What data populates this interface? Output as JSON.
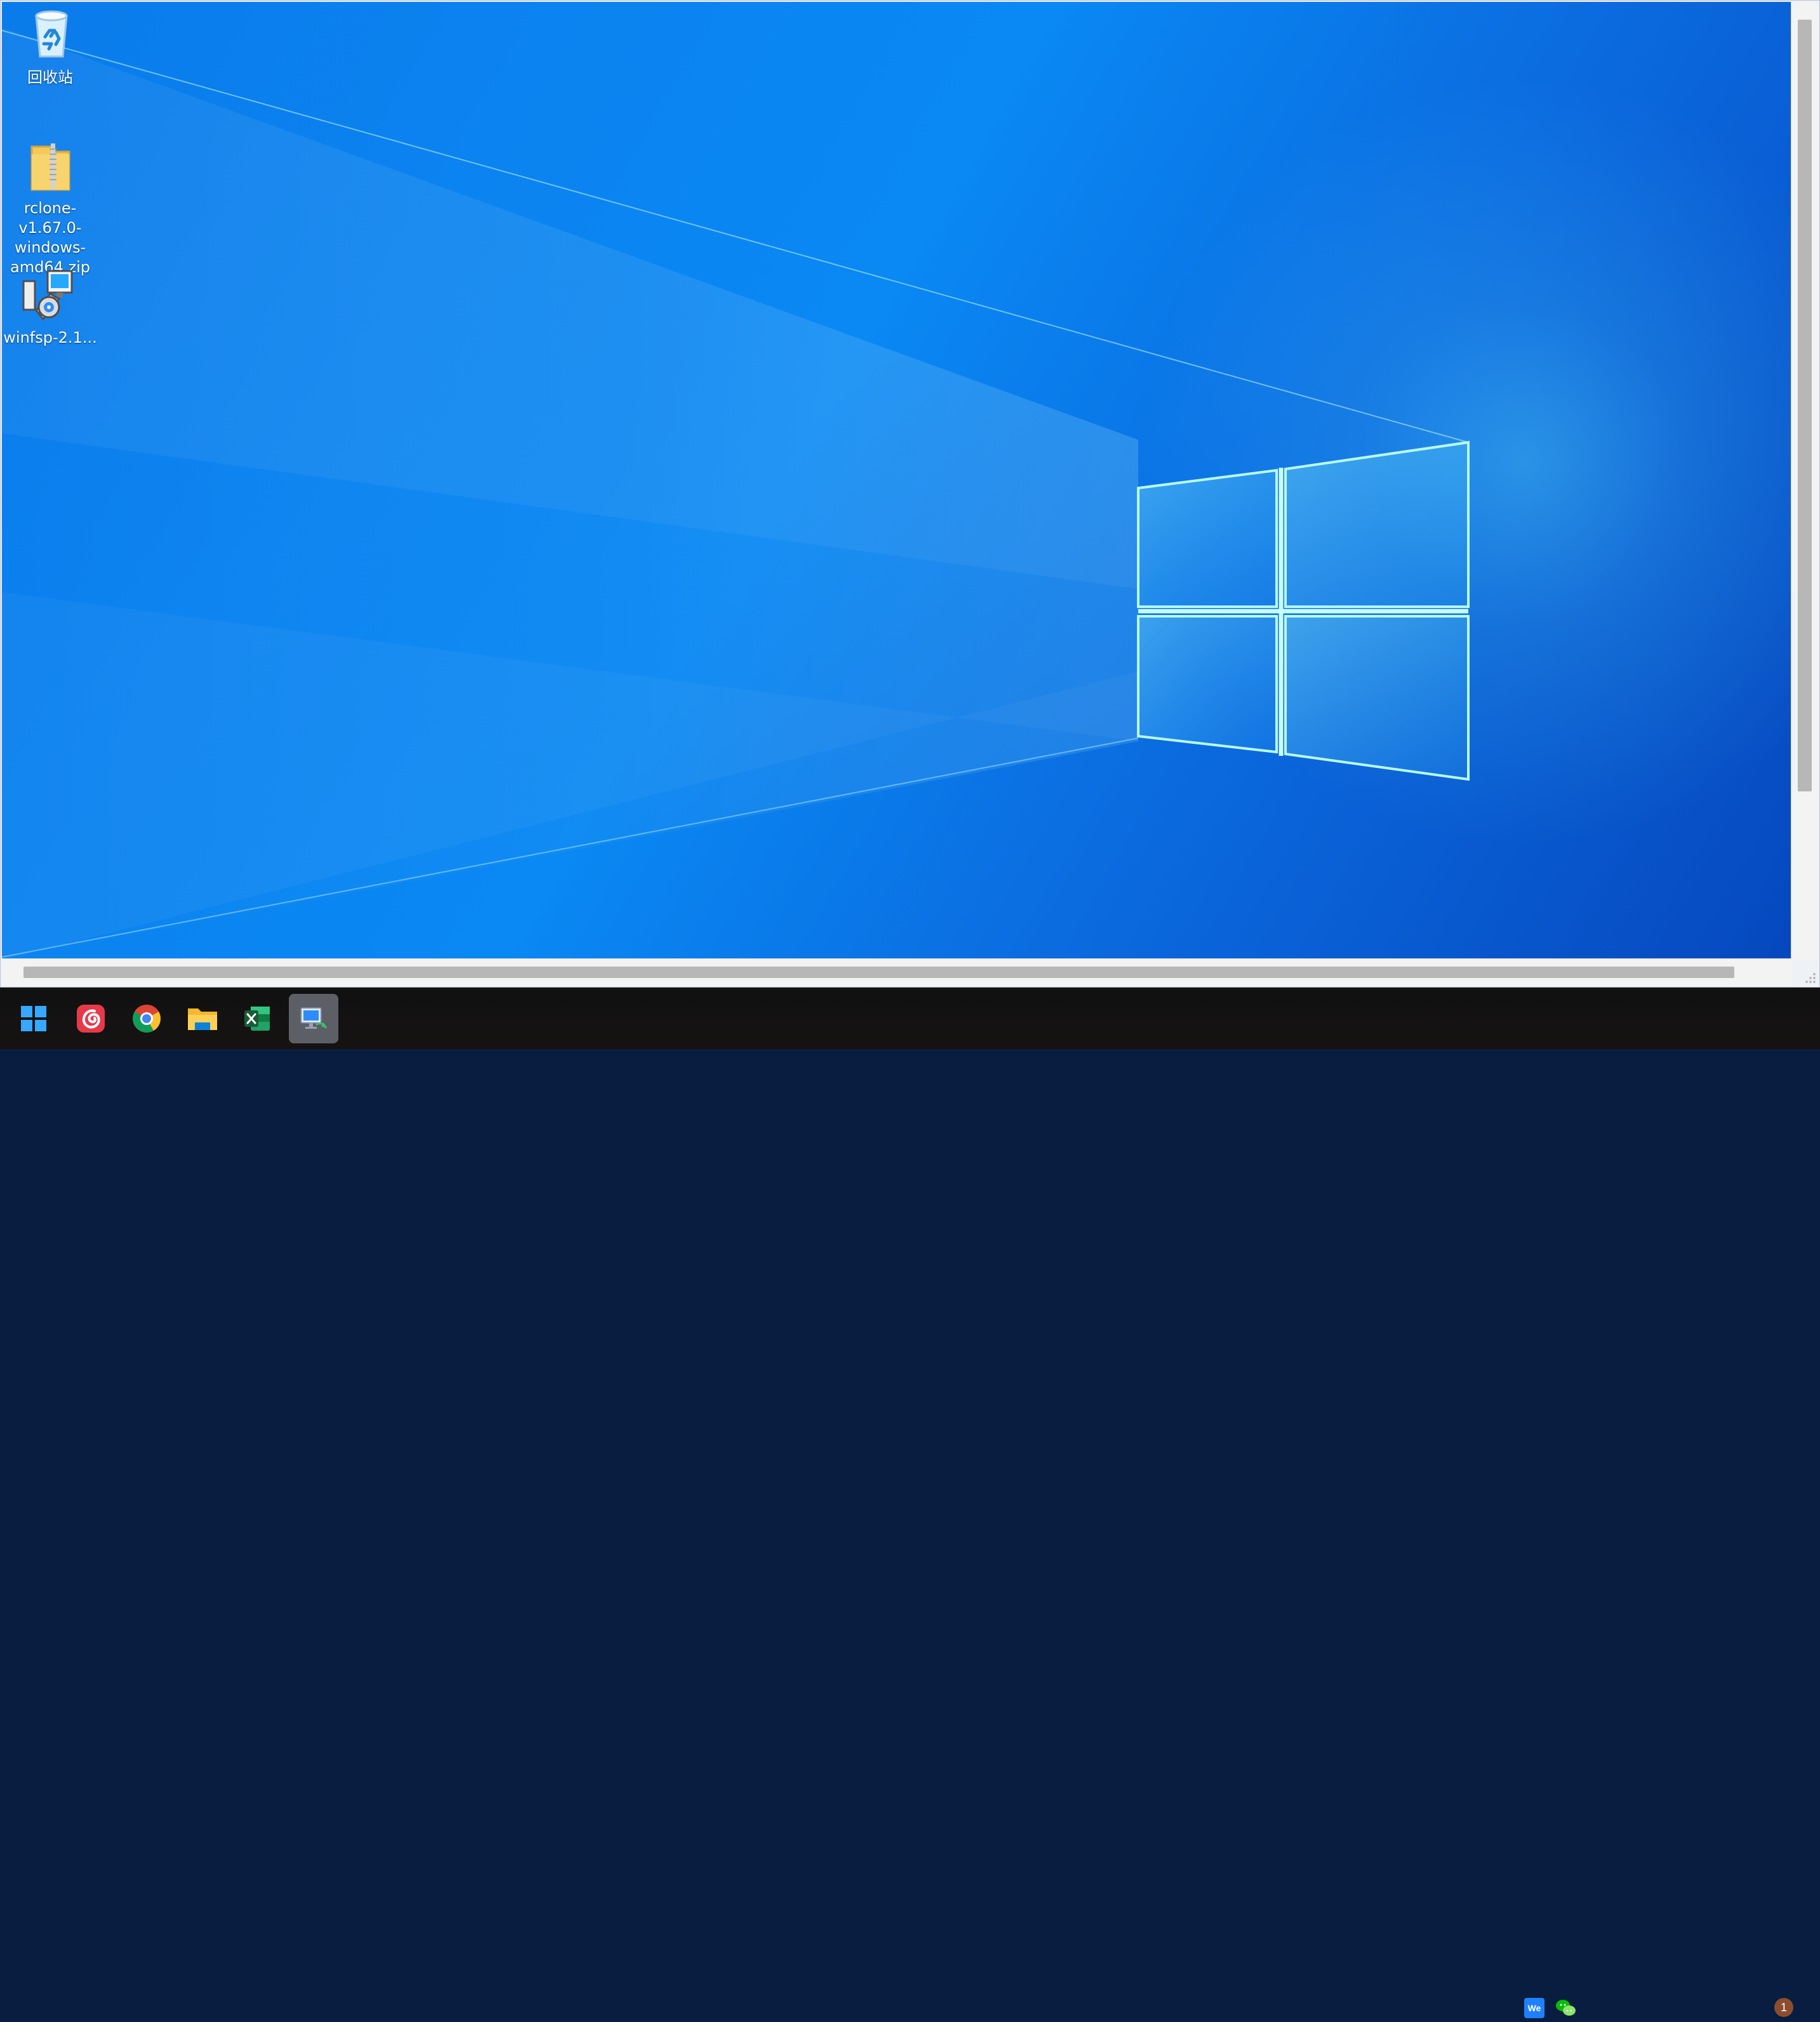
{
  "desktop": {
    "icons": [
      {
        "label": "回收站",
        "icon": "recycle-bin-icon"
      },
      {
        "label": "rclone-v1.67.0-windows-amd64.zip",
        "icon": "zip-folder-icon"
      },
      {
        "label": "winfsp-2.1...",
        "icon": "installer-icon"
      }
    ]
  },
  "taskbar": {
    "items": [
      {
        "name": "start-button",
        "icon": "windows-start-icon"
      },
      {
        "name": "netease-music-button",
        "icon": "music-app-icon"
      },
      {
        "name": "chrome-button",
        "icon": "chrome-icon"
      },
      {
        "name": "file-explorer-button",
        "icon": "folder-icon"
      },
      {
        "name": "excel-button",
        "icon": "excel-icon"
      },
      {
        "name": "remote-desktop-button",
        "icon": "remote-desktop-icon",
        "active": true
      }
    ],
    "tray": {
      "we_label": "We",
      "notification_count": "1"
    }
  },
  "colors": {
    "taskbar_bg": "#141313",
    "active_button": "#5c5f66",
    "desktop_blue": "#0b82f0",
    "scroll_thumb": "#b7b7b7"
  }
}
